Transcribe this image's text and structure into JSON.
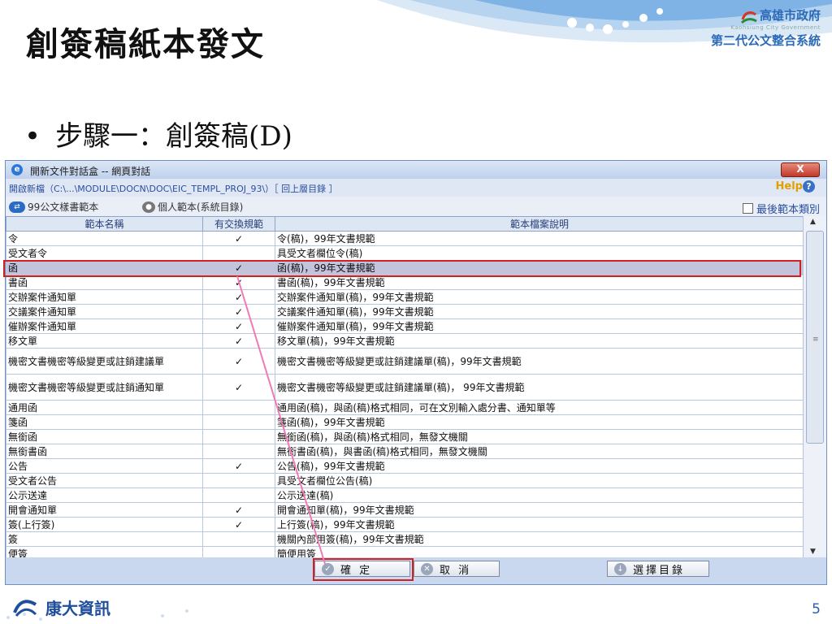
{
  "slide": {
    "title": "創簽稿紙本發文",
    "bullet": "步驟一：創簽稿(D)",
    "brand": "康大資訊",
    "page_number": "5"
  },
  "logo": {
    "name": "高雄市政府",
    "subtitle": "Kaohsiung City Government",
    "system": "第二代公文整合系統"
  },
  "dialog": {
    "title": "開新文件對話盒 -- 網頁對話",
    "close_label": "X",
    "path": "開啟新檔（C:\\...\\MODULE\\DOCN\\DOC\\EIC_TEMPL_PROJ_93\\）［ 回上層目錄 ］",
    "help": "Help",
    "toolbar": {
      "template_99": "99公文樣書範本",
      "personal_template": "個人範本(系統目錄)",
      "last_category": "最後範本類別"
    },
    "columns": [
      "範本名稱",
      "有交換規範",
      "範本檔案說明"
    ],
    "rows": [
      {
        "name": "令",
        "exchange": "✓",
        "desc": "令(稿)，99年文書規範"
      },
      {
        "name": "受文者令",
        "exchange": "",
        "desc": "具受文者欄位令(稿)"
      },
      {
        "name": "函",
        "exchange": "✓",
        "desc": "函(稿)，99年文書規範"
      },
      {
        "name": "書函",
        "exchange": "✓",
        "desc": "書函(稿)，99年文書規範"
      },
      {
        "name": "交辦案件通知單",
        "exchange": "✓",
        "desc": "交辦案件通知單(稿)，99年文書規範"
      },
      {
        "name": "交議案件通知單",
        "exchange": "✓",
        "desc": "交議案件通知單(稿)，99年文書規範"
      },
      {
        "name": "催辦案件通知單",
        "exchange": "✓",
        "desc": "催辦案件通知單(稿)，99年文書規範"
      },
      {
        "name": "移文單",
        "exchange": "✓",
        "desc": "移文單(稿)，99年文書規範"
      },
      {
        "name": "機密文書機密等級變更或註銷建議單",
        "exchange": "✓",
        "desc": "機密文書機密等級變更或註銷建議單(稿)，99年文書規範"
      },
      {
        "name": "機密文書機密等級變更或註銷通知單",
        "exchange": "✓",
        "desc": "機密文書機密等級變更或註銷建議單(稿)， 99年文書規範"
      },
      {
        "name": "通用函",
        "exchange": "",
        "desc": "通用函(稿)，與函(稿)格式相同，可在文別輸入處分書、通知單等"
      },
      {
        "name": "箋函",
        "exchange": "",
        "desc": "箋函(稿)，99年文書規範"
      },
      {
        "name": "無銜函",
        "exchange": "",
        "desc": "無銜函(稿)，與函(稿)格式相同，無發文機關"
      },
      {
        "name": "無銜書函",
        "exchange": "",
        "desc": "無銜書函(稿)，與書函(稿)格式相同，無發文機關"
      },
      {
        "name": "公告",
        "exchange": "✓",
        "desc": "公告(稿)，99年文書規範"
      },
      {
        "name": "受文者公告",
        "exchange": "",
        "desc": "具受文者欄位公告(稿)"
      },
      {
        "name": "公示送達",
        "exchange": "",
        "desc": "公示送達(稿)"
      },
      {
        "name": "開會通知單",
        "exchange": "✓",
        "desc": "開會通知單(稿)，99年文書規範"
      },
      {
        "name": "簽(上行簽)",
        "exchange": "✓",
        "desc": "上行簽(稿)，99年文書規範"
      },
      {
        "name": "簽",
        "exchange": "",
        "desc": "機關內部用簽(稿)，99年文書規範"
      },
      {
        "name": "便簽",
        "exchange": "",
        "desc": "簡便用簽"
      }
    ],
    "selected_row": 2,
    "buttons": {
      "ok": "確 定",
      "cancel": "取 消",
      "choose_dir": "選擇目錄"
    }
  },
  "colors": {
    "accent": "#d02020",
    "dialog_bg": "#c9d8ee",
    "selected_row": "#c3c3dc",
    "header_text": "#2a3f7a"
  }
}
